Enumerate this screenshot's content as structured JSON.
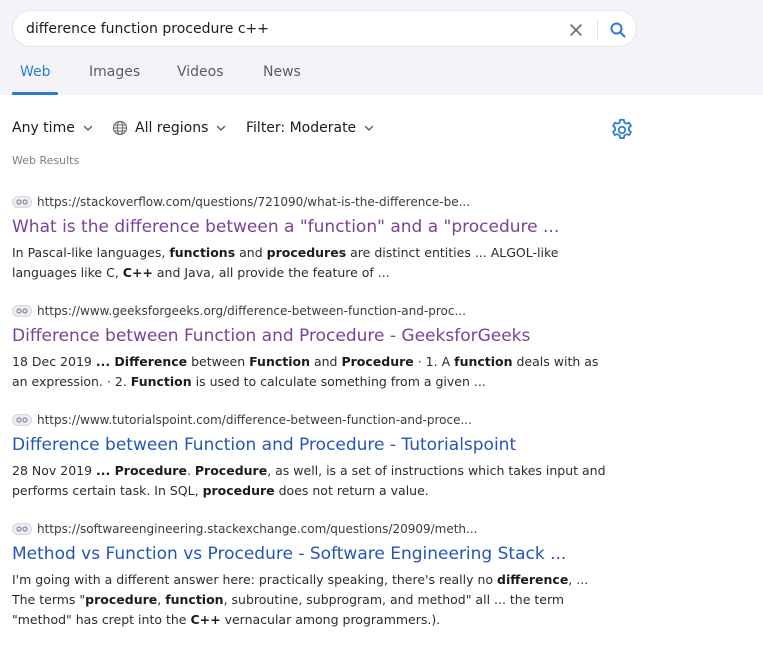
{
  "search": {
    "query": "difference function procedure c++",
    "clear_icon": "close-icon",
    "submit_icon": "search-icon"
  },
  "tabs": [
    {
      "label": "Web",
      "active": true
    },
    {
      "label": "Images",
      "active": false
    },
    {
      "label": "Videos",
      "active": false
    },
    {
      "label": "News",
      "active": false
    }
  ],
  "filters": {
    "time": "Any time",
    "region": "All regions",
    "safe": "Filter: Moderate",
    "settings_icon": "gear-icon"
  },
  "section_label": "Web Results",
  "colors": {
    "accent": "#2b7cd3",
    "visited_link": "#7c4099",
    "link": "#2455b8"
  },
  "results": [
    {
      "url": "https://stackoverflow.com/questions/721090/what-is-the-difference-be...",
      "title": "What is the difference between a \"function\" and a \"procedure ...",
      "visited": true,
      "snippet": [
        {
          "t": "In Pascal-like languages, "
        },
        {
          "t": "functions",
          "b": true
        },
        {
          "t": " and "
        },
        {
          "t": "procedures",
          "b": true
        },
        {
          "t": " are distinct entities ... ALGOL-like languages like C, "
        },
        {
          "t": "C++",
          "b": true
        },
        {
          "t": " and Java, all provide the feature of ..."
        }
      ]
    },
    {
      "url": "https://www.geeksforgeeks.org/difference-between-function-and-proc...",
      "title": "Difference between Function and Procedure - GeeksforGeeks",
      "visited": true,
      "snippet": [
        {
          "t": "18 Dec 2019 "
        },
        {
          "t": "... Difference",
          "b": true
        },
        {
          "t": " between "
        },
        {
          "t": "Function",
          "b": true
        },
        {
          "t": " and "
        },
        {
          "t": "Procedure",
          "b": true
        },
        {
          "t": " · 1. A "
        },
        {
          "t": "function",
          "b": true
        },
        {
          "t": " deals with as an expression. · 2. "
        },
        {
          "t": "Function",
          "b": true
        },
        {
          "t": " is used to calculate something from a given ..."
        }
      ]
    },
    {
      "url": "https://www.tutorialspoint.com/difference-between-function-and-proce...",
      "title": "Difference between Function and Procedure - Tutorialspoint",
      "visited": false,
      "snippet": [
        {
          "t": "28 Nov 2019 "
        },
        {
          "t": "... Procedure",
          "b": true
        },
        {
          "t": ". "
        },
        {
          "t": "Procedure",
          "b": true
        },
        {
          "t": ", as well, is a set of instructions which takes input and performs certain task. In SQL, "
        },
        {
          "t": "procedure",
          "b": true
        },
        {
          "t": " does not return a value."
        }
      ]
    },
    {
      "url": "https://softwareengineering.stackexchange.com/questions/20909/meth...",
      "title": "Method vs Function vs Procedure - Software Engineering Stack ...",
      "visited": false,
      "snippet": [
        {
          "t": "I'm going with a different answer here: practically speaking, there's really no "
        },
        {
          "t": "difference",
          "b": true
        },
        {
          "t": ", ... The terms \""
        },
        {
          "t": "procedure",
          "b": true
        },
        {
          "t": ", "
        },
        {
          "t": "function",
          "b": true
        },
        {
          "t": ", subroutine, subprogram, and method\" all ... the term \"method\" has crept into the "
        },
        {
          "t": "C++",
          "b": true
        },
        {
          "t": " vernacular among programmers.)."
        }
      ]
    }
  ]
}
